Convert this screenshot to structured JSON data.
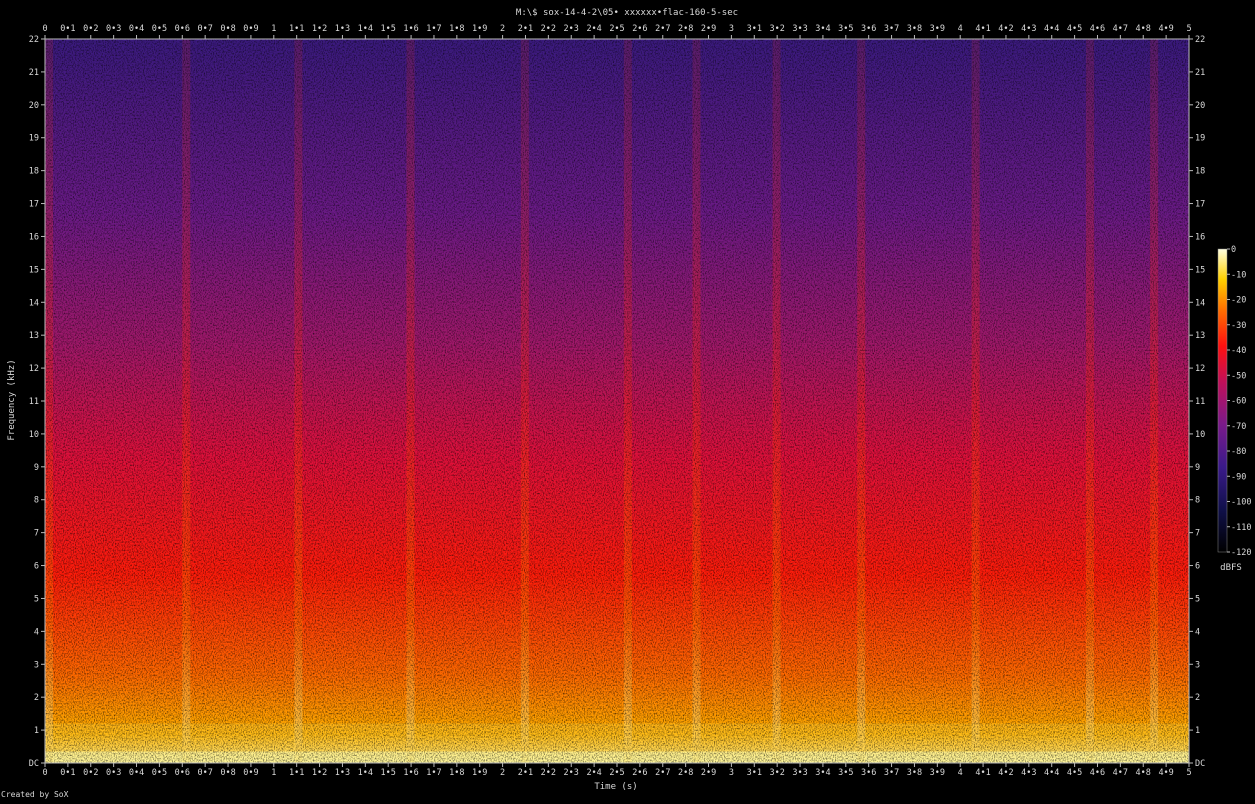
{
  "chart_data": {
    "type": "heatmap",
    "title": "M:\\$ sox-14-4-2\\05• xxxxxx•flac-160-5-sec",
    "xlabel": "Time (s)",
    "ylabel": "Frequency (kHz)",
    "xlim": [
      0,
      5
    ],
    "ylim": [
      0,
      22
    ],
    "x_ticks": [
      "0",
      "0•1",
      "0•2",
      "0•3",
      "0•4",
      "0•5",
      "0•6",
      "0•7",
      "0•8",
      "0•9",
      "1",
      "1•1",
      "1•2",
      "1•3",
      "1•4",
      "1•5",
      "1•6",
      "1•7",
      "1•8",
      "1•9",
      "2",
      "2•1",
      "2•2",
      "2•3",
      "2•4",
      "2•5",
      "2•6",
      "2•7",
      "2•8",
      "2•9",
      "3",
      "3•1",
      "3•2",
      "3•3",
      "3•4",
      "3•5",
      "3•6",
      "3•7",
      "3•8",
      "3•9",
      "4",
      "4•1",
      "4•2",
      "4•3",
      "4•4",
      "4•5",
      "4•6",
      "4•7",
      "4•8",
      "4•9",
      "5"
    ],
    "y_ticks": [
      "DC",
      "1",
      "2",
      "3",
      "4",
      "5",
      "6",
      "7",
      "8",
      "9",
      "10",
      "11",
      "12",
      "13",
      "14",
      "15",
      "16",
      "17",
      "18",
      "19",
      "20",
      "21",
      "22"
    ],
    "colorbar": {
      "label": "dBFS",
      "range": [
        -120,
        0
      ],
      "ticks": [
        "0",
        "-10",
        "-20",
        "-30",
        "-40",
        "-50",
        "-60",
        "-70",
        "-80",
        "-90",
        "-100",
        "-110",
        "-120"
      ]
    },
    "onsets_s": [
      0.0,
      0.6,
      1.09,
      1.58,
      2.08,
      2.53,
      2.83,
      3.18,
      3.55,
      4.05,
      4.55,
      4.83
    ],
    "colors": {
      "high": "#ffffd0",
      "mid": "#ff1010",
      "low": "#3a1a8a",
      "floor": "#000000"
    }
  },
  "footer": {
    "credit": "Created by SoX"
  }
}
